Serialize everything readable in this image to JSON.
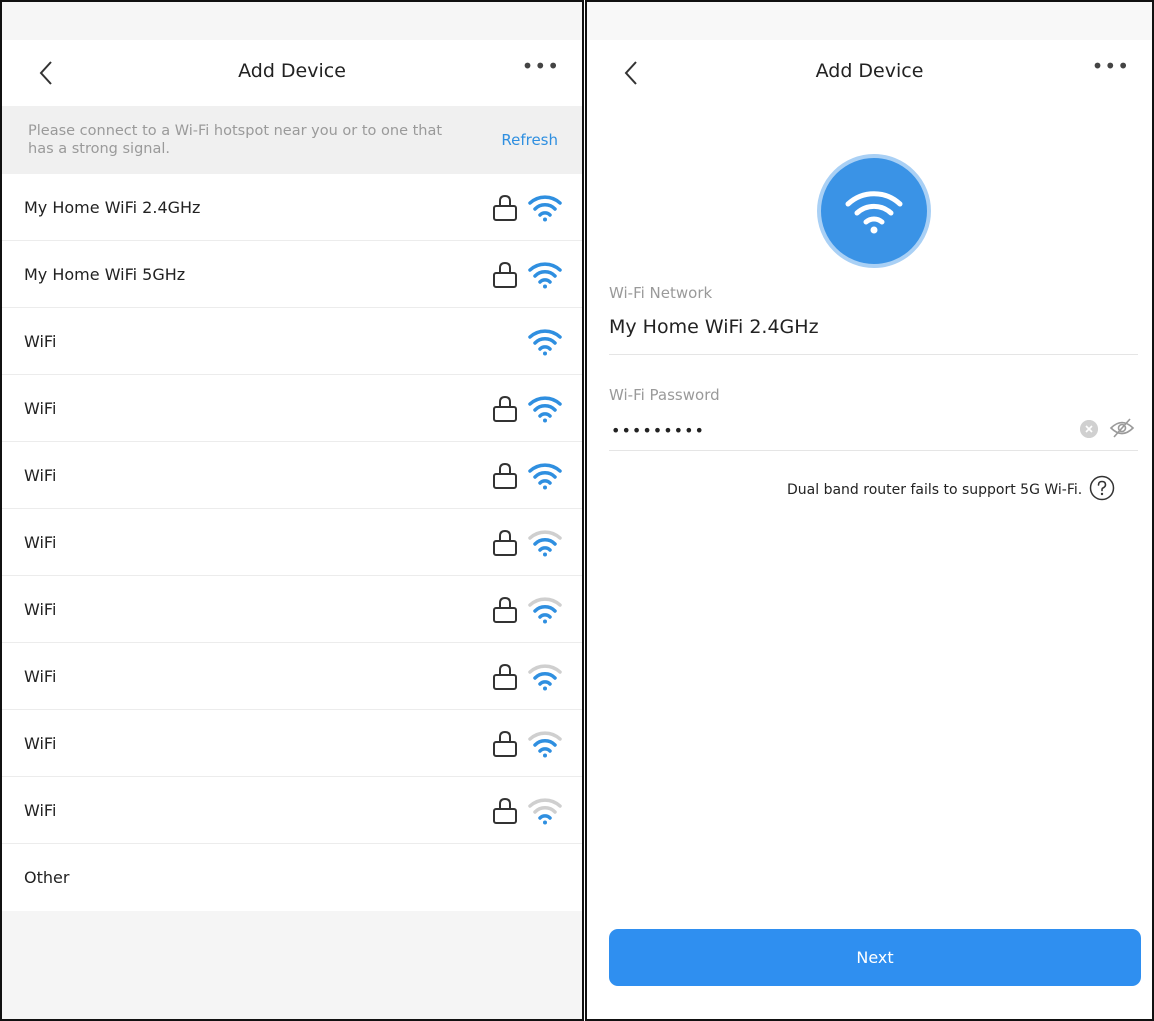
{
  "left_screen": {
    "title": "Add Device",
    "more_label": "•••",
    "notice": "Please connect to a Wi-Fi hotspot near you or to one that has a strong signal.",
    "refresh_label": "Refresh",
    "networks": [
      {
        "ssid": "My Home WiFi 2.4GHz",
        "locked": true,
        "signal": 3
      },
      {
        "ssid": "My Home WiFi 5GHz",
        "locked": true,
        "signal": 3
      },
      {
        "ssid": "WiFi",
        "locked": false,
        "signal": 3
      },
      {
        "ssid": "WiFi",
        "locked": true,
        "signal": 3
      },
      {
        "ssid": "WiFi",
        "locked": true,
        "signal": 3
      },
      {
        "ssid": "WiFi",
        "locked": true,
        "signal": 2
      },
      {
        "ssid": "WiFi",
        "locked": true,
        "signal": 2
      },
      {
        "ssid": "WiFi",
        "locked": true,
        "signal": 2
      },
      {
        "ssid": "WiFi",
        "locked": true,
        "signal": 2
      },
      {
        "ssid": "WiFi",
        "locked": true,
        "signal": 1
      }
    ],
    "other_label": "Other"
  },
  "right_screen": {
    "title": "Add Device",
    "more_label": "•••",
    "network_label": "Wi-Fi Network",
    "network_value": "My Home WiFi 2.4GHz",
    "password_label": "Wi-Fi Password",
    "password_value": "•••••••••",
    "hint": "Dual band router fails to support 5G Wi-Fi.",
    "next_label": "Next"
  },
  "colors": {
    "accent": "#2f8ff0",
    "wifi_active": "#2f8fe0",
    "wifi_inactive": "#cfcfcf",
    "muted_text": "#9a9a9a"
  }
}
